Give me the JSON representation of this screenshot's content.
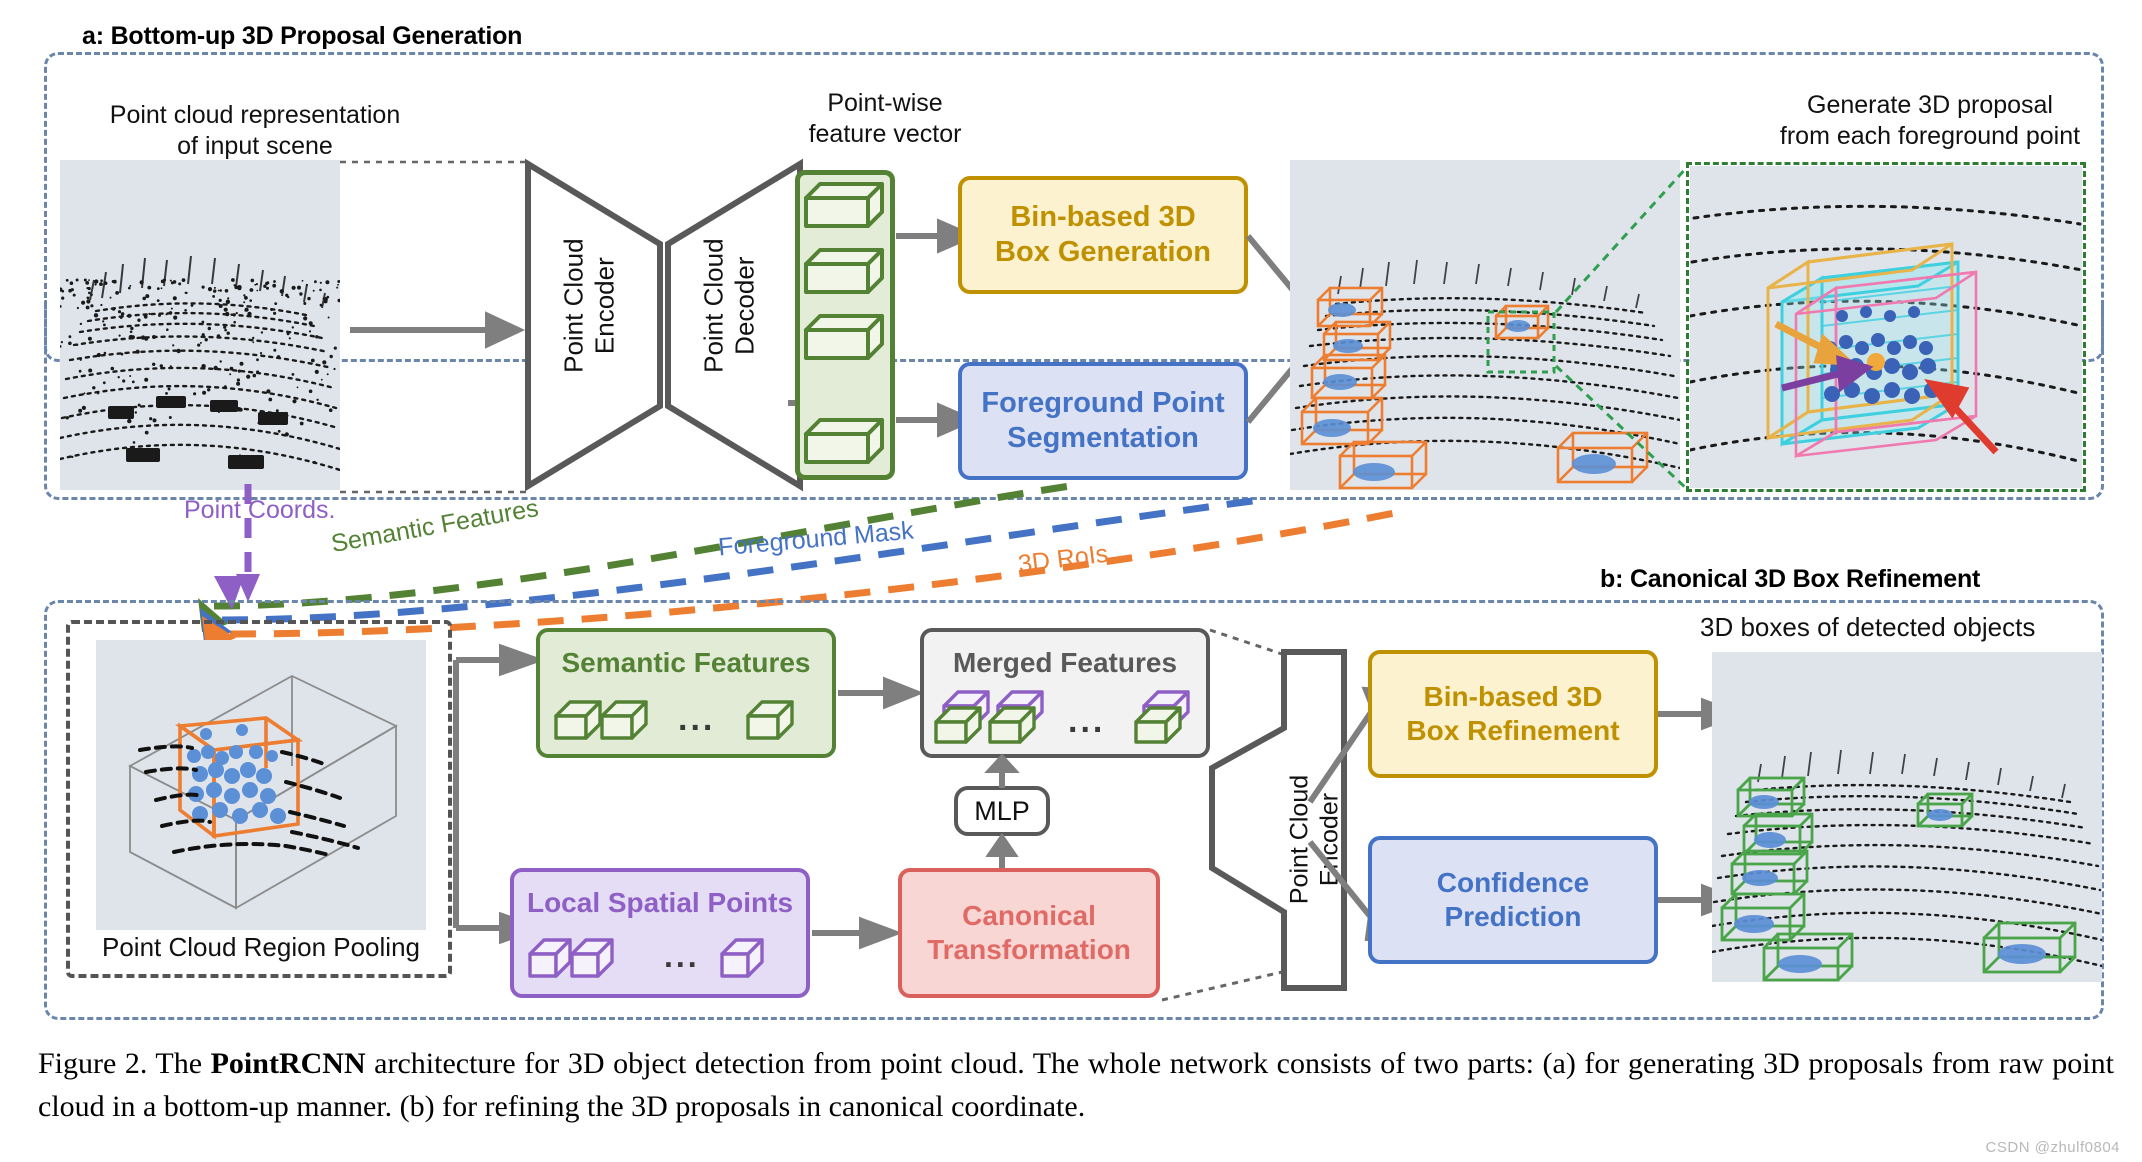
{
  "figure": {
    "panel_a_title": "a: Bottom-up 3D Proposal Generation",
    "panel_b_title": "b: Canonical 3D Box Refinement",
    "caption_pre": "Figure 2. The ",
    "caption_bold": "PointRCNN",
    "caption_post": " architecture for 3D object detection from point cloud.  The whole network consists of two parts: (a) for generating 3D proposals from raw point cloud in a bottom-up manner. (b) for refining the 3D proposals in canonical coordinate.",
    "watermark": "CSDN @zhulf0804"
  },
  "panel_a": {
    "input_label_line1": "Point cloud representation",
    "input_label_line2": "of input scene",
    "feature_label_line1": "Point-wise",
    "feature_label_line2": "feature vector",
    "encoder_label_line1": "Point Cloud",
    "encoder_label_line2": "Encoder",
    "decoder_label_line1": "Point Cloud",
    "decoder_label_line2": "Decoder",
    "box_generation_line1": "Bin-based 3D",
    "box_generation_line2": "Box Generation",
    "segmentation_line1": "Foreground Point",
    "segmentation_line2": "Segmentation",
    "proposal_label_line1": "Generate 3D proposal",
    "proposal_label_line2": "from each foreground point"
  },
  "connectors": {
    "point_coords": "Point Coords.",
    "semantic_features": "Semantic Features",
    "foreground_mask": "Foreground Mask",
    "rois": "3D RoIs"
  },
  "panel_b": {
    "pooling_label": "Point Cloud Region Pooling",
    "semantic_features": "Semantic Features",
    "merged_features": "Merged Features",
    "local_spatial_points": "Local Spatial Points",
    "canonical_line1": "Canonical",
    "canonical_line2": "Transformation",
    "mlp": "MLP",
    "encoder_label_line1": "Point Cloud",
    "encoder_label_line2": "Encoder",
    "box_refinement_line1": "Bin-based 3D",
    "box_refinement_line2": "Box Refinement",
    "confidence_line1": "Confidence",
    "confidence_line2": "Prediction",
    "output_label": "3D boxes of detected objects",
    "ellipsis": "..."
  },
  "colors": {
    "panel_border": "#6b86ad",
    "gold": "#bf9000",
    "blue": "#4472c4",
    "green": "#548235",
    "purple": "#8e5fc4",
    "red": "#d9605b",
    "grey": "#595959",
    "orange": "#ed7d31",
    "scene_bg": "#dfe4ea"
  }
}
